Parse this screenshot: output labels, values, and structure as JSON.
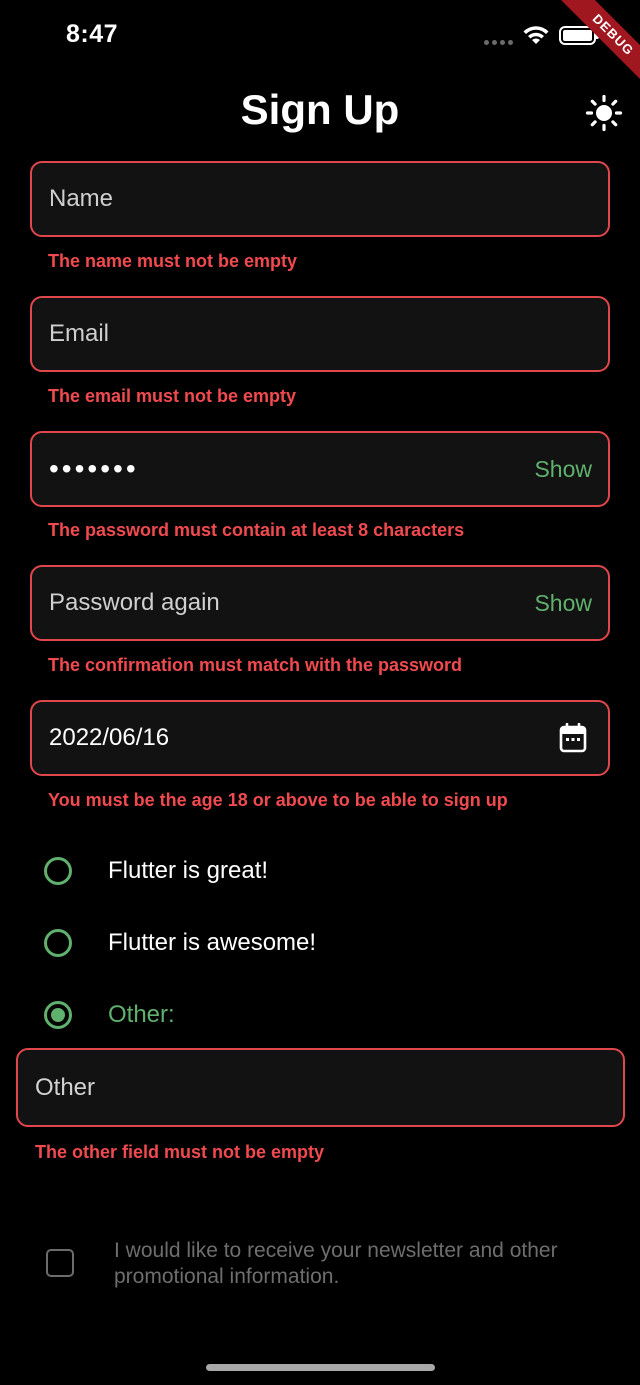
{
  "status_bar": {
    "time": "8:47"
  },
  "debug_banner": {
    "label": "DEBUG"
  },
  "header": {
    "title": "Sign Up",
    "theme_icon": "sun-icon"
  },
  "form": {
    "name": {
      "placeholder": "Name",
      "error": "The name must not be empty"
    },
    "email": {
      "placeholder": "Email",
      "error": "The email must not be empty"
    },
    "password": {
      "value": "•••••••",
      "show_label": "Show",
      "error": "The password must contain at least 8 characters"
    },
    "password_again": {
      "placeholder": "Password again",
      "show_label": "Show",
      "error": "The confirmation must match with the password"
    },
    "birthdate": {
      "value": "2022/06/16",
      "icon": "calendar-icon",
      "error": "You must be the age 18 or above to be able to sign up"
    },
    "radio_options": [
      {
        "label": "Flutter is great!",
        "checked": false
      },
      {
        "label": "Flutter is awesome!",
        "checked": false
      },
      {
        "label": "Other:",
        "checked": true
      }
    ],
    "other": {
      "placeholder": "Other",
      "error": "The other field must not be empty"
    },
    "newsletter": {
      "label": "I would like to receive your newsletter and other promotional information.",
      "checked": false
    }
  },
  "colors": {
    "accent": "#5fb16d",
    "error": "#f04a4f",
    "background": "#000000",
    "field_bg": "#121212"
  }
}
